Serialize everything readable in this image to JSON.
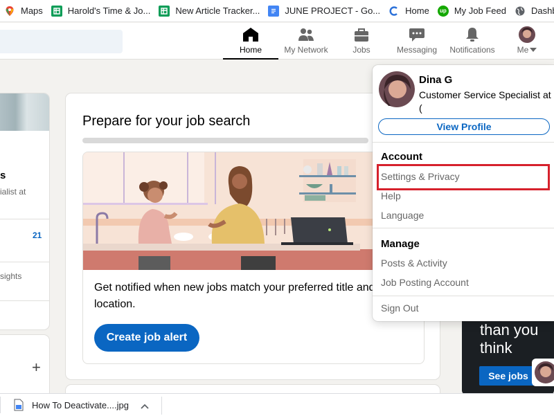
{
  "bookmarks": [
    {
      "label": "Maps",
      "icon": "maps-icon",
      "color": "#34a853"
    },
    {
      "label": "Harold's Time & Jo...",
      "icon": "sheets-icon",
      "color": "#0f9d58"
    },
    {
      "label": "New Article Tracker...",
      "icon": "sheets-icon",
      "color": "#0f9d58"
    },
    {
      "label": "JUNE PROJECT - Go...",
      "icon": "docs-icon",
      "color": "#4285f4"
    },
    {
      "label": "Home",
      "icon": "c-logo-icon",
      "color": "#2d72d9"
    },
    {
      "label": "My Job Feed",
      "icon": "upwork-icon",
      "color": "#14a800"
    },
    {
      "label": "Dashboard c",
      "icon": "globe-icon",
      "color": "#5f6368"
    }
  ],
  "nav": {
    "items": [
      {
        "label": "Home",
        "icon": "home-icon",
        "active": true
      },
      {
        "label": "My Network",
        "icon": "network-icon"
      },
      {
        "label": "Jobs",
        "icon": "briefcase-icon"
      },
      {
        "label": "Messaging",
        "icon": "chat-icon"
      },
      {
        "label": "Notifications",
        "icon": "bell-icon"
      },
      {
        "label": "Me",
        "icon": "avatar-icon"
      }
    ]
  },
  "left_sidebar": {
    "name_fragment": "s",
    "headline_fragment": "ialist at",
    "count": "21",
    "insights_fragment": "sights",
    "plus": "+"
  },
  "main": {
    "title": "Prepare for your job search",
    "notify_text": "Get notified when new jobs match your preferred title and location.",
    "cta": "Create job alert"
  },
  "ad": {
    "text_line1": "than you",
    "text_line2": "think",
    "button": "See jobs"
  },
  "dropdown": {
    "name": "Dina G",
    "headline": "Customer Service Specialist at",
    "headline_cont": "(",
    "view_profile": "View Profile",
    "account_title": "Account",
    "account_items": [
      "Settings & Privacy",
      "Help",
      "Language"
    ],
    "manage_title": "Manage",
    "manage_items": [
      "Posts & Activity",
      "Job Posting Account"
    ],
    "sign_out": "Sign Out"
  },
  "download": {
    "file": "How To Deactivate....jpg"
  },
  "colors": {
    "brand": "#0a66c2",
    "highlight": "#d6212c",
    "page_bg": "#f3f2ef"
  }
}
